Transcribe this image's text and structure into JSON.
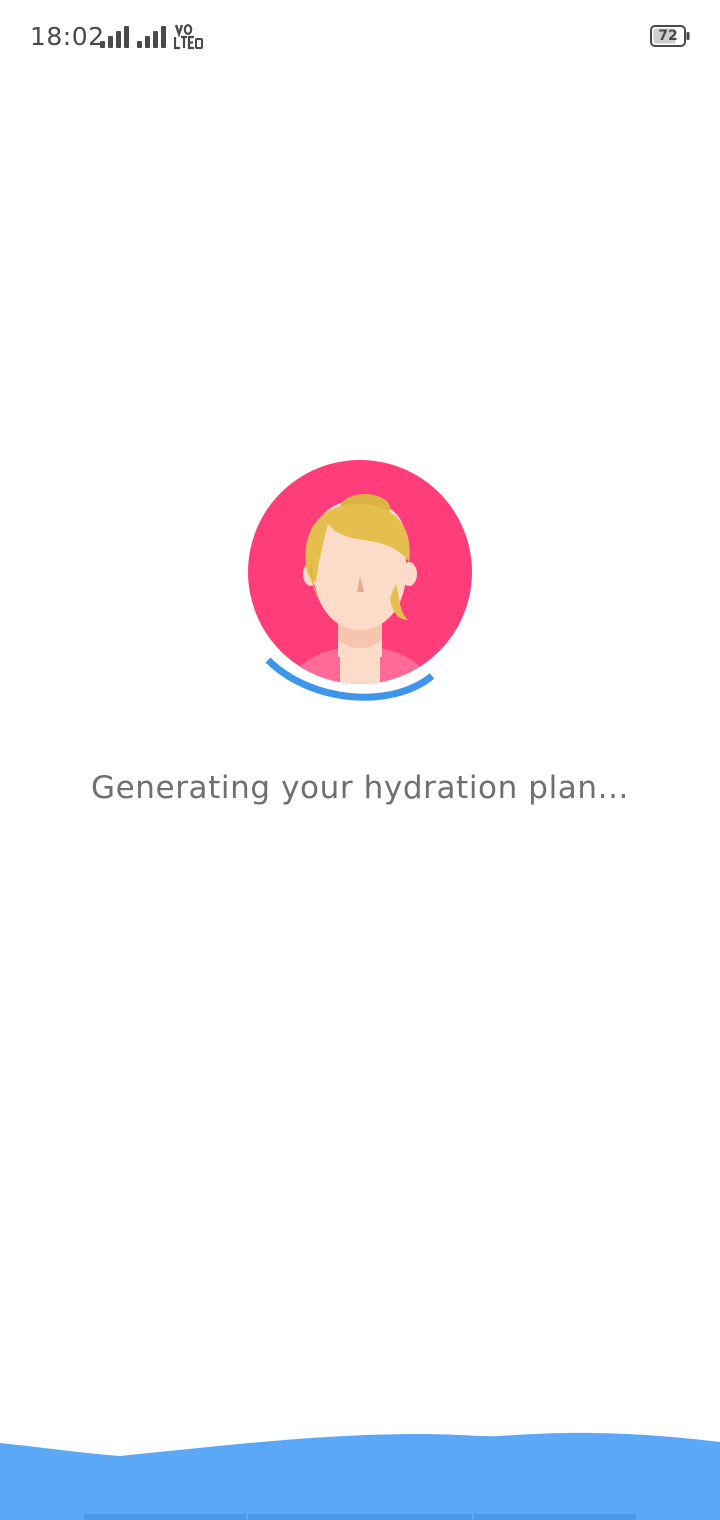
{
  "status_bar": {
    "time": "18:02",
    "battery_level": "72",
    "network_badge": "VoLTE",
    "icons": [
      "signal-icon",
      "signal-icon",
      "volte-icon",
      "battery-icon"
    ]
  },
  "main": {
    "avatar": "female-avatar-icon",
    "loading_message": "Generating your hydration plan...",
    "progress_indicator": "spinner-arc-icon"
  },
  "colors": {
    "avatar_background": "#FF3D7A",
    "spinner": "#3D96EC",
    "wave": "#5BA8F7",
    "text": "#6F6F6F",
    "hair": "#E6BE4E",
    "skin": "#FDDBC9"
  }
}
